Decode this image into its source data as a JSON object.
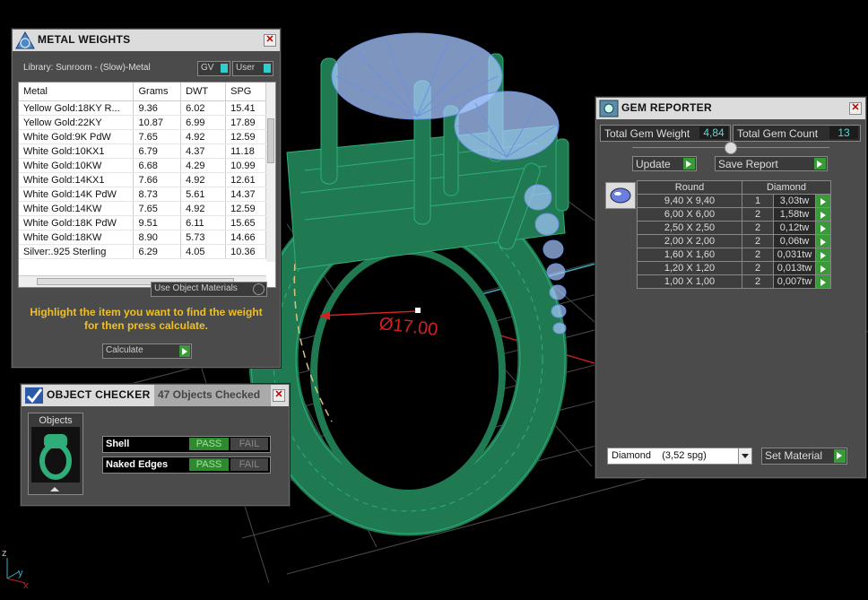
{
  "viewport": {
    "dimension_label": "Ø17.00",
    "axis_z": "z",
    "axis_y": "y",
    "axis_x": "x",
    "colors": {
      "ring": "#1f7a52",
      "wire": "#2fae7a",
      "gem": "#a8c8ff",
      "grid": "#555555",
      "accent": "#d42020"
    }
  },
  "metal_weights": {
    "title": "METAL WEIGHTS",
    "library_label": "Library: Sunroom - (Slow)-Metal",
    "toggle_gv": "GV",
    "toggle_user": "User",
    "columns": [
      "Metal",
      "Grams",
      "DWT",
      "SPG"
    ],
    "rows": [
      [
        "Yellow Gold:18KY R...",
        "9.36",
        "6.02",
        "15.41"
      ],
      [
        "Yellow Gold:22KY",
        "10.87",
        "6.99",
        "17.89"
      ],
      [
        "White Gold:9K PdW",
        "7.65",
        "4.92",
        "12.59"
      ],
      [
        "White Gold:10KX1",
        "6.79",
        "4.37",
        "11.18"
      ],
      [
        "White Gold:10KW",
        "6.68",
        "4.29",
        "10.99"
      ],
      [
        "White Gold:14KX1",
        "7.66",
        "4.92",
        "12.61"
      ],
      [
        "White Gold:14K PdW",
        "8.73",
        "5.61",
        "14.37"
      ],
      [
        "White Gold:14KW",
        "7.65",
        "4.92",
        "12.59"
      ],
      [
        "White Gold:18K PdW",
        "9.51",
        "6.11",
        "15.65"
      ],
      [
        "White Gold:18KW",
        "8.90",
        "5.73",
        "14.66"
      ],
      [
        "Silver:.925 Sterling",
        "6.29",
        "4.05",
        "10.36"
      ]
    ],
    "use_object_materials": "Use Object Materials",
    "hint": "Highlight the item you want to find the weight for then press calculate.",
    "calculate_label": "Calculate"
  },
  "object_checker": {
    "title": "OBJECT CHECKER",
    "summary": "47  Objects Checked",
    "objects_label": "Objects",
    "checks": [
      {
        "name": "Shell",
        "pass": "PASS",
        "fail": "FAIL"
      },
      {
        "name": "Naked Edges",
        "pass": "PASS",
        "fail": "FAIL"
      }
    ]
  },
  "gem_reporter": {
    "title": "GEM REPORTER",
    "total_weight_label": "Total Gem Weight",
    "total_weight": "4,84",
    "total_count_label": "Total Gem Count",
    "total_count": "13",
    "update_label": "Update",
    "save_report_label": "Save Report",
    "header_cut": "Round",
    "header_material": "Diamond",
    "gems": [
      {
        "size": "9,40 X 9,40",
        "count": "1",
        "weight": "3,03tw"
      },
      {
        "size": "6,00 X 6,00",
        "count": "2",
        "weight": "1,58tw"
      },
      {
        "size": "2,50 X 2,50",
        "count": "2",
        "weight": "0,12tw"
      },
      {
        "size": "2,00 X 2,00",
        "count": "2",
        "weight": "0,06tw"
      },
      {
        "size": "1,60 X 1,60",
        "count": "2",
        "weight": "0,031tw"
      },
      {
        "size": "1,20 X 1,20",
        "count": "2",
        "weight": "0,013tw"
      },
      {
        "size": "1,00 X 1,00",
        "count": "2",
        "weight": "0,007tw"
      }
    ],
    "material_select": "Diamond    (3,52 spg)",
    "set_material_label": "Set Material"
  }
}
